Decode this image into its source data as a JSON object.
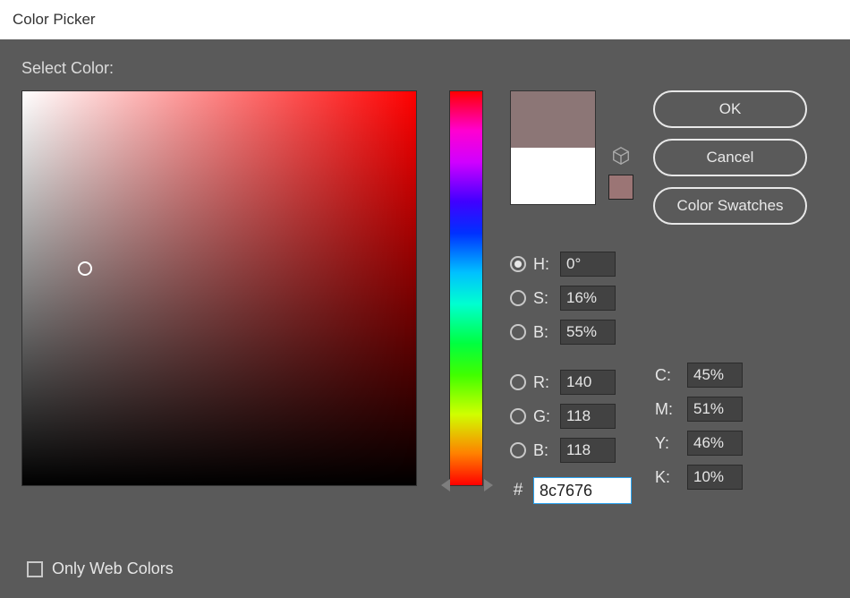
{
  "title": "Color Picker",
  "select_label": "Select Color:",
  "buttons": {
    "ok": "OK",
    "cancel": "Cancel",
    "swatches": "Color Swatches"
  },
  "preview": {
    "new_color": "#8c7676",
    "old_color": "#ffffff",
    "chip_color": "#9b7575"
  },
  "hsb": {
    "h_label": "H:",
    "s_label": "S:",
    "b_label": "B:",
    "h": "0°",
    "s": "16%",
    "b": "55%"
  },
  "rgb": {
    "r_label": "R:",
    "g_label": "G:",
    "b_label": "B:",
    "r": "140",
    "g": "118",
    "b": "118"
  },
  "cmyk": {
    "c_label": "C:",
    "m_label": "M:",
    "y_label": "Y:",
    "k_label": "K:",
    "c": "45%",
    "m": "51%",
    "y": "46%",
    "k": "10%"
  },
  "hex": {
    "hash": "#",
    "value": "8c7676"
  },
  "only_web": "Only Web Colors",
  "radio_selected": "H"
}
